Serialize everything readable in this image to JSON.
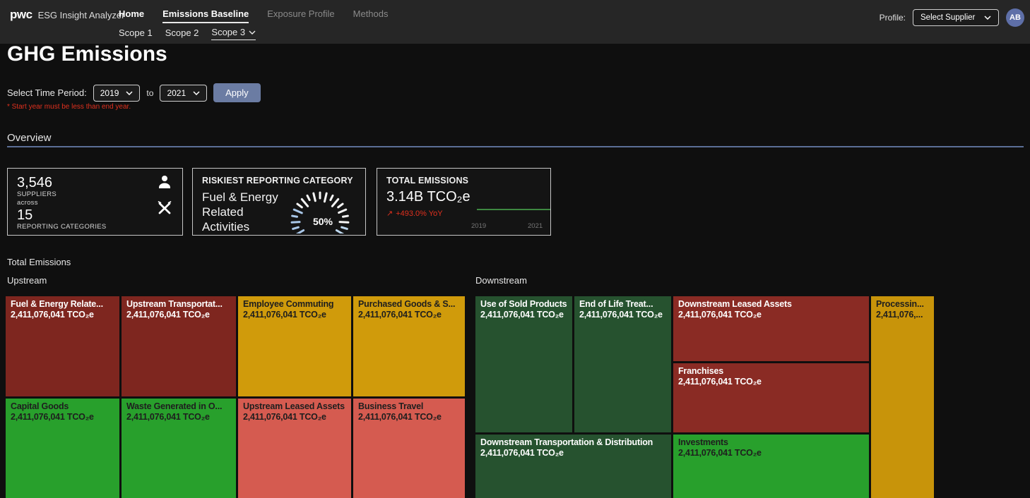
{
  "header": {
    "logo": "pwc",
    "app_title": "ESG Insight Analyzer",
    "nav": [
      {
        "label": "Home"
      },
      {
        "label": "Emissions Baseline"
      },
      {
        "label": "Exposure Profile"
      },
      {
        "label": "Methods"
      }
    ],
    "scopes": [
      {
        "label": "Scope 1"
      },
      {
        "label": "Scope 2"
      },
      {
        "label": "Scope 3"
      }
    ],
    "profile_label": "Profile:",
    "profile_value": "Select Supplier",
    "avatar_initials": "AB",
    "avatar_color": "#5e6fa8"
  },
  "page": {
    "title": "GHG Emissions",
    "time_filter": {
      "label": "Select Time Period:",
      "start_year": "2019",
      "to": "to",
      "end_year": "2021",
      "apply_label": "Apply",
      "error": "* Start year must be less than end year.",
      "error_color": "#e0301e"
    },
    "overview_title": "Overview",
    "accent_color": "#5b6e96"
  },
  "cards": {
    "suppliers": {
      "count": "3,546",
      "count_label": "SUPPLIERS",
      "across": "across",
      "categories_count": "15",
      "categories_label": "REPORTING CATEGORIES"
    },
    "riskiest": {
      "title": "RISKIEST REPORTING CATEGORY",
      "category": "Fuel & Energy Related Activities",
      "gauge_value": "50%"
    },
    "total": {
      "title": "TOTAL EMISSIONS",
      "value": "3.14B TCO₂e",
      "trend_arrow": "↗",
      "trend": "+493.0% YoY",
      "trend_color": "#e0301e",
      "sparkline_color": "#4caf50",
      "x_start": "2019",
      "x_end": "2021"
    }
  },
  "treemap": {
    "section_title": "Total Emissions",
    "upstream": {
      "title": "Upstream",
      "tiles": [
        {
          "name": "Fuel & Energy Relate...",
          "value": "2,411,076,041 TCO₂e",
          "color": "#7e261f"
        },
        {
          "name": "Upstream Transportat...",
          "value": "2,411,076,041 TCO₂e",
          "color": "#7e261f"
        },
        {
          "name": "Employee Commuting",
          "value": "2,411,076,041 TCO₂e",
          "color": "#d09b0b"
        },
        {
          "name": "Purchased Goods & S...",
          "value": "2,411,076,041 TCO₂e",
          "color": "#d09b0b"
        },
        {
          "name": "Capital Goods",
          "value": "2,411,076,041 TCO₂e",
          "color": "#28a02c"
        },
        {
          "name": "Waste Generated in O...",
          "value": "2,411,076,041 TCO₂e",
          "color": "#28a02c"
        },
        {
          "name": "Upstream Leased Assets",
          "value": "2,411,076,041 TCO₂e",
          "color": "#d55b50"
        },
        {
          "name": "Business Travel",
          "value": "2,411,076,041 TCO₂e",
          "color": "#d55b50"
        }
      ]
    },
    "downstream": {
      "title": "Downstream",
      "tiles": [
        {
          "name": "Use of Sold Products",
          "value": "2,411,076,041 TCO₂e",
          "color": "#26522f"
        },
        {
          "name": "End of Life Treat...",
          "value": "2,411,076,041 TCO₂e",
          "color": "#26522f"
        },
        {
          "name": "Downstream Leased Assets",
          "value": "2,411,076,041 TCO₂e",
          "color": "#8a2b24"
        },
        {
          "name": "Franchises",
          "value": "2,411,076,041 TCO₂e",
          "color": "#8a2b24"
        },
        {
          "name": "Downstream Transportation & Distribution",
          "value": "2,411,076,041 TCO₂e",
          "color": "#26522f"
        },
        {
          "name": "Investments",
          "value": "2,411,076,041 TCO₂e",
          "color": "#28a02c"
        },
        {
          "name": "Processin...",
          "value": "2,411,076,...",
          "color": "#c8940a"
        }
      ]
    }
  }
}
